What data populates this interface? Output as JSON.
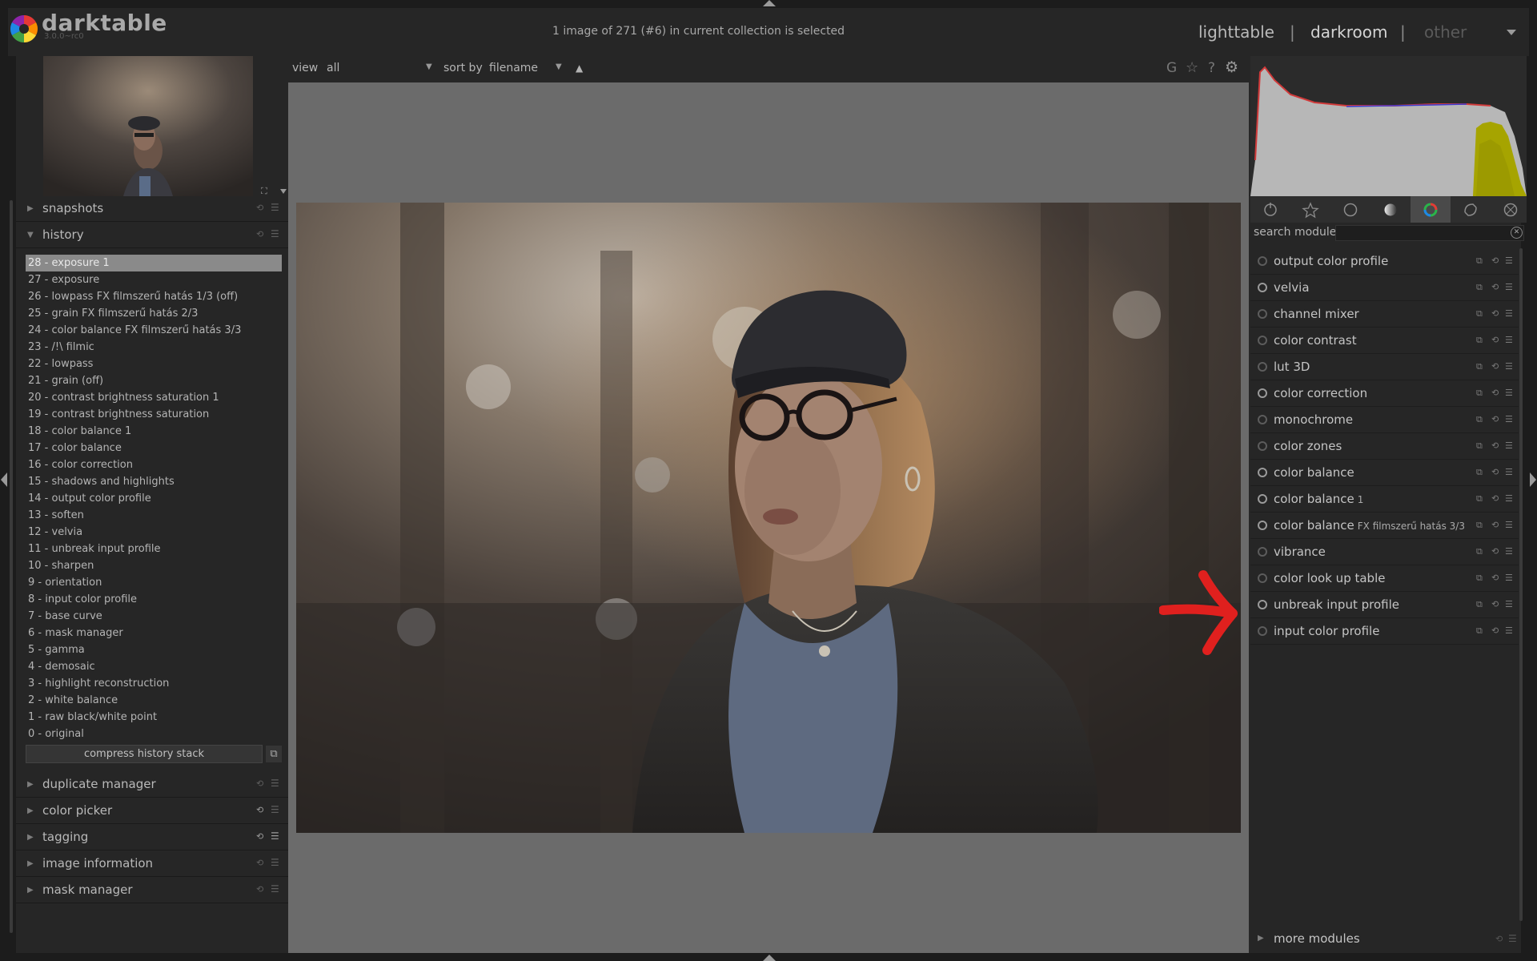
{
  "app": {
    "name": "darktable",
    "version": "3.0.0~rc0",
    "status": "1 image of 271 (#6) in current collection is selected"
  },
  "views": {
    "lighttable": "lighttable",
    "sep1": "|",
    "darkroom": "darkroom",
    "sep2": "|",
    "other": "other"
  },
  "filmstrip_bar": {
    "view_label": "view",
    "view_value": "all",
    "sort_label": "sort by",
    "sort_value": "filename",
    "sort_dir": "▲",
    "g_label": "G",
    "star": "☆",
    "help": "?"
  },
  "left_modules": {
    "snapshots": "snapshots",
    "history": "history",
    "duplicate_manager": "duplicate manager",
    "color_picker": "color picker",
    "tagging": "tagging",
    "image_information": "image information",
    "mask_manager": "mask manager"
  },
  "history_items": [
    "28 - exposure 1",
    "27 - exposure",
    "26 - lowpass FX filmszerű hatás 1/3 (off)",
    "25 - grain FX filmszerű hatás 2/3",
    "24 - color balance FX filmszerű hatás 3/3",
    "23 - /!\\ filmic",
    "22 - lowpass",
    "21 - grain (off)",
    "20 - contrast brightness saturation 1",
    "19 - contrast brightness saturation",
    "18 - color balance 1",
    "17 - color balance",
    "16 - color correction",
    "15 - shadows and highlights",
    "14 - output color profile",
    "13 - soften",
    "12 - velvia",
    "11 - unbreak input profile",
    "10 - sharpen",
    "9 - orientation",
    "8 - input color profile",
    "7 - base curve",
    "6 - mask manager",
    "5 - gamma",
    "4 - demosaic",
    "3 - highlight reconstruction",
    "2 - white balance",
    "1 - raw black/white point",
    "0 - original"
  ],
  "history_selected_index": 0,
  "compress_label": "compress history stack",
  "search": {
    "label": "search module",
    "value": ""
  },
  "right_modules": [
    {
      "name": "output color profile",
      "suffix": "",
      "on": false
    },
    {
      "name": "velvia",
      "suffix": "",
      "on": true
    },
    {
      "name": "channel mixer",
      "suffix": "",
      "on": false
    },
    {
      "name": "color contrast",
      "suffix": "",
      "on": false
    },
    {
      "name": "lut 3D",
      "suffix": "",
      "on": false
    },
    {
      "name": "color correction",
      "suffix": "",
      "on": true
    },
    {
      "name": "monochrome",
      "suffix": "",
      "on": false
    },
    {
      "name": "color zones",
      "suffix": "",
      "on": false
    },
    {
      "name": "color balance",
      "suffix": "",
      "on": true
    },
    {
      "name": "color balance",
      "suffix": "1",
      "on": true
    },
    {
      "name": "color balance",
      "suffix": "FX filmszerű hatás 3/3",
      "on": true
    },
    {
      "name": "vibrance",
      "suffix": "",
      "on": false
    },
    {
      "name": "color look up table",
      "suffix": "",
      "on": false
    },
    {
      "name": "unbreak input profile",
      "suffix": "",
      "on": true
    },
    {
      "name": "input color profile",
      "suffix": "",
      "on": false
    }
  ],
  "more_modules": "more modules",
  "colors": {
    "accent_red": "#e0201e",
    "panel_bg": "#262626",
    "center_bg": "#6b6b6b"
  }
}
